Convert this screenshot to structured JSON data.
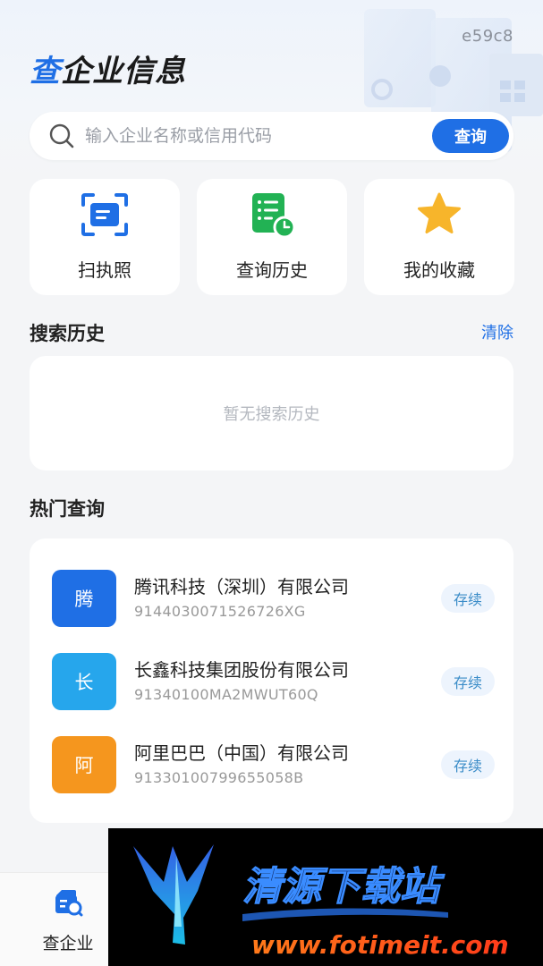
{
  "header": {
    "build_id": "e59c8",
    "title_accent": "查",
    "title_rest": "企业信息"
  },
  "search": {
    "placeholder": "输入企业名称或信用代码",
    "button_label": "查询"
  },
  "quick_actions": [
    {
      "label": "扫执照",
      "icon": "scan-license-icon"
    },
    {
      "label": "查询历史",
      "icon": "history-list-icon"
    },
    {
      "label": "我的收藏",
      "icon": "star-icon"
    }
  ],
  "search_history": {
    "title": "搜索历史",
    "clear_label": "清除",
    "empty_text": "暂无搜索历史"
  },
  "hot_queries": {
    "title": "热门查询",
    "items": [
      {
        "logo_char": "腾",
        "name": "腾讯科技（深圳）有限公司",
        "code": "9144030071526726XG",
        "status": "存续",
        "color": "#1f6fe5"
      },
      {
        "logo_char": "长",
        "name": "长鑫科技集团股份有限公司",
        "code": "91340100MA2MWUT60Q",
        "status": "存续",
        "color": "#26a6ec"
      },
      {
        "logo_char": "阿",
        "name": "阿里巴巴（中国）有限公司",
        "code": "91330100799655058B",
        "status": "存续",
        "color": "#f5961e"
      }
    ]
  },
  "bottom_nav": {
    "items": [
      {
        "label": "查企业",
        "icon": "company-search-icon"
      }
    ]
  },
  "watermark": {
    "brand": "清源下载站",
    "url": "www.fotimeit.com"
  },
  "colors": {
    "accent": "#1f6fe5",
    "background": "#f4f5f7",
    "status_bg": "#edf4fd",
    "status_text": "#3a8cc8"
  }
}
